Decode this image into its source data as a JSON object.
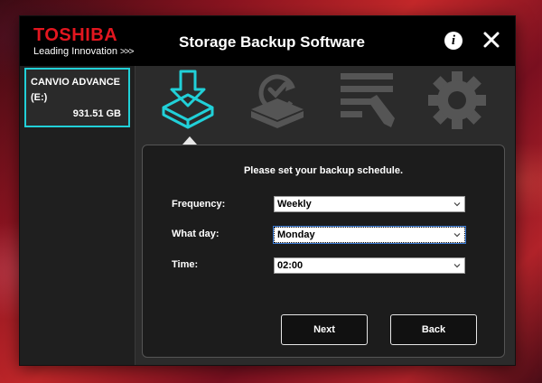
{
  "app": {
    "brand": "TOSHIBA",
    "tagline": "Leading Innovation",
    "tagline_chevrons": ">>>",
    "title": "Storage Backup Software",
    "info_glyph": "i",
    "close_icon": "close-icon",
    "accent_color": "#21d0d8",
    "brand_color": "#e3161f"
  },
  "sidebar": {
    "drive": {
      "name": "CANVIO ADVANCE",
      "letter": "(E:)",
      "size": "931.51 GB"
    }
  },
  "toolbar": {
    "tools": [
      {
        "icon": "backup-download-icon",
        "active": true
      },
      {
        "icon": "restore-clock-icon",
        "active": false
      },
      {
        "icon": "edit-list-icon",
        "active": false
      },
      {
        "icon": "settings-gear-icon",
        "active": false
      }
    ]
  },
  "schedule": {
    "prompt": "Please set your backup schedule.",
    "frequency_label": "Frequency:",
    "frequency_value": "Weekly",
    "day_label": "What day:",
    "day_value": "Monday",
    "time_label": "Time:",
    "time_value": "02:00"
  },
  "buttons": {
    "next": "Next",
    "back": "Back"
  }
}
